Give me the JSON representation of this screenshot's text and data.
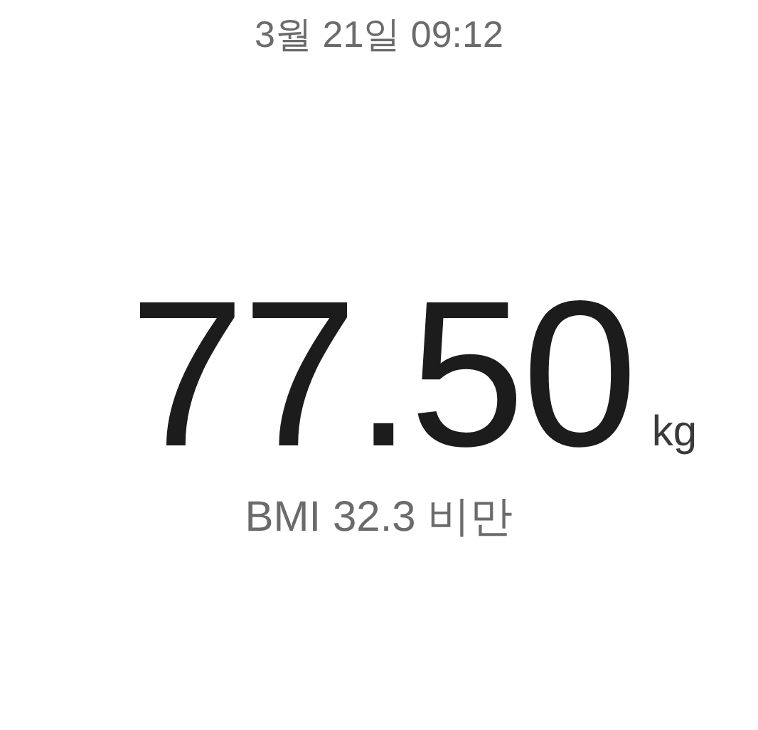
{
  "timestamp": "3월 21일 09:12",
  "weight": {
    "value": "77.50",
    "unit": "kg"
  },
  "bmi": "BMI 32.3 비만"
}
